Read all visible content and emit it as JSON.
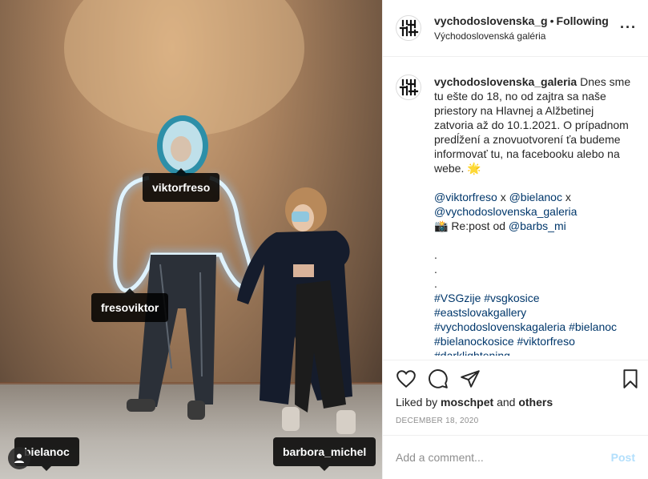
{
  "post": {
    "username": "vychodoslovenska_g",
    "separator": "•",
    "follow_status": "Following",
    "location": "Východoslovenská galéria",
    "more_icon": "more-horizontal-icon"
  },
  "photo_tags": {
    "tag1": "viktorfreso",
    "tag2": "fresoviktor",
    "tag3": "bielanoc",
    "tag4": "barbora_michel"
  },
  "caption": {
    "username": "vychodoslovenska_galeria",
    "line1": "Dnes sme",
    "line2": "tu ešte do 18, no od zajtra sa naše",
    "line3": "priestory na Hlavnej a Alžbetinej",
    "line4": "zatvoria až do 10.1.2021. O prípadnom",
    "line5": "predĺžení a znovuotvorení ťa budeme",
    "line6": "informovať tu, na facebooku alebo na",
    "line7": "webe. 🌟",
    "mention1": "@viktorfreso",
    "x1": "x",
    "mention2": "@bielanoc",
    "x2": "x",
    "mention3": "@vychodoslovenska_galeria",
    "repost_prefix": "📸 Re:post od",
    "mention4": "@barbs_mi",
    "dot1": ".",
    "dot2": ".",
    "dot3": ".",
    "hashtag1": "#VSGzije #vsgkosice",
    "hashtag2": "#eastslovakgallery",
    "hashtag3": "#vychodoslovenskagaleria #bielanoc",
    "hashtag4": "#bielanockosice #viktorfreso",
    "hashtag5": "#darklightening"
  },
  "actions": {
    "like_icon": "heart-icon",
    "comment_icon": "comment-icon",
    "share_icon": "share-icon",
    "save_icon": "bookmark-icon"
  },
  "likes": {
    "prefix": "Liked by",
    "user": "moschpet",
    "and": "and",
    "others": "others"
  },
  "date": "DECEMBER 18, 2020",
  "comment_box": {
    "placeholder": "Add a comment...",
    "post_label": "Post"
  }
}
